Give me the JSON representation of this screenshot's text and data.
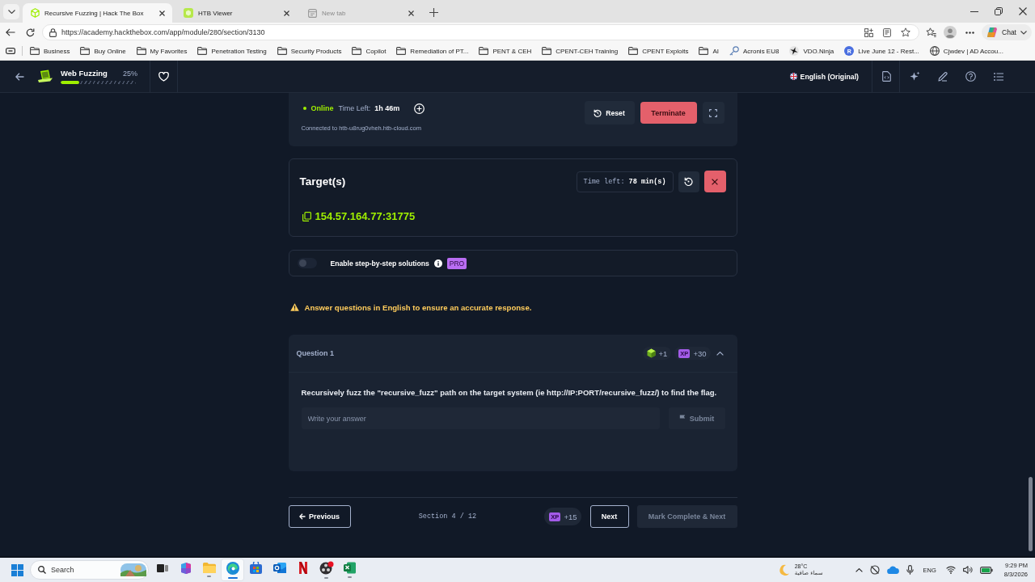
{
  "browser": {
    "tabs": [
      {
        "title": "Recursive Fuzzing | Hack The Box",
        "kind": "htb",
        "selected": true
      },
      {
        "title": "HTB Viewer",
        "kind": "viewer",
        "selected": false
      },
      {
        "title": "New tab",
        "kind": "blank",
        "selected": false
      }
    ],
    "address": "https://academy.hackthebox.com/app/module/280/section/3130",
    "chat_label": "Chat",
    "bookmarks": [
      {
        "label": "Business",
        "kind": "folder"
      },
      {
        "label": "Buy Online",
        "kind": "folder"
      },
      {
        "label": "My Favorites",
        "kind": "folder"
      },
      {
        "label": "Penetration Testing",
        "kind": "folder"
      },
      {
        "label": "Security Products",
        "kind": "folder"
      },
      {
        "label": "Copilot",
        "kind": "folder"
      },
      {
        "label": "Remediation of PT...",
        "kind": "folder"
      },
      {
        "label": "PENT & CEH",
        "kind": "folder"
      },
      {
        "label": "CPENT-CEH Training",
        "kind": "folder"
      },
      {
        "label": "CPENT Exploits",
        "kind": "folder"
      },
      {
        "label": "AI",
        "kind": "folder"
      },
      {
        "label": "Acronis EU8",
        "kind": "key"
      },
      {
        "label": "VDO.Ninja",
        "kind": "star"
      },
      {
        "label": "Live June 12 - Rest...",
        "kind": "letter",
        "letter": "R"
      },
      {
        "label": "Cjwdev | AD Accou...",
        "kind": "globe"
      }
    ]
  },
  "header": {
    "module_title": "Web Fuzzing",
    "progress": {
      "reading": "25%",
      "level": 0.25
    },
    "language": "English (Original)"
  },
  "session": {
    "status": "Online",
    "time_left_label": "Time Left:",
    "time_left": "1h 46m",
    "connection": "Connected to htb-u8rug0vheh.htb-cloud.com",
    "reset_label": "Reset",
    "terminate_label": "Terminate"
  },
  "target": {
    "title": "Target(s)",
    "time_left_label": "Time left:",
    "time_left": "78 min(s)",
    "address": "154.57.164.77:31775"
  },
  "solutions_toggle": {
    "label": "Enable step-by-step solutions",
    "on": false,
    "badge": "PRO"
  },
  "warning": "Answer questions in English to ensure an accurate response.",
  "question": {
    "title": "Question 1",
    "rewards": [
      {
        "kind": "cube",
        "value": "+1"
      },
      {
        "kind": "xp",
        "tag": "XP",
        "value": "+30"
      }
    ],
    "expanded": true,
    "text": "Recursively fuzz the \"recursive_fuzz\" path on the target system (ie http://IP:PORT/recursive_fuzz/) to find the flag.",
    "placeholder": "Write your answer",
    "submit": {
      "label": "Submit",
      "disabled": true
    }
  },
  "footer": {
    "previous": "Previous",
    "section": "Section 4 / 12",
    "reward": {
      "tag": "XP",
      "value": "+15"
    },
    "next": "Next",
    "complete": {
      "label": "Mark Complete & Next",
      "disabled": true
    }
  },
  "taskbar": {
    "search_placeholder": "Search",
    "apps": [
      {
        "kind": "task-view",
        "running": false,
        "selected": false
      },
      {
        "kind": "office",
        "running": false,
        "selected": false
      },
      {
        "kind": "explorer",
        "running": true,
        "selected": false
      },
      {
        "kind": "edge",
        "running": true,
        "selected": true
      },
      {
        "kind": "store",
        "running": false,
        "selected": false
      },
      {
        "kind": "outlook",
        "running": false,
        "selected": false
      },
      {
        "kind": "netflix",
        "running": false,
        "selected": false
      },
      {
        "kind": "obs",
        "running": true,
        "selected": false
      },
      {
        "kind": "excel",
        "running": true,
        "selected": false
      }
    ],
    "weather": {
      "temperature": "28°C",
      "condition": "سماء صافية"
    },
    "language": "ENG",
    "time": "9:29 PM",
    "date": "8/3/2026"
  }
}
